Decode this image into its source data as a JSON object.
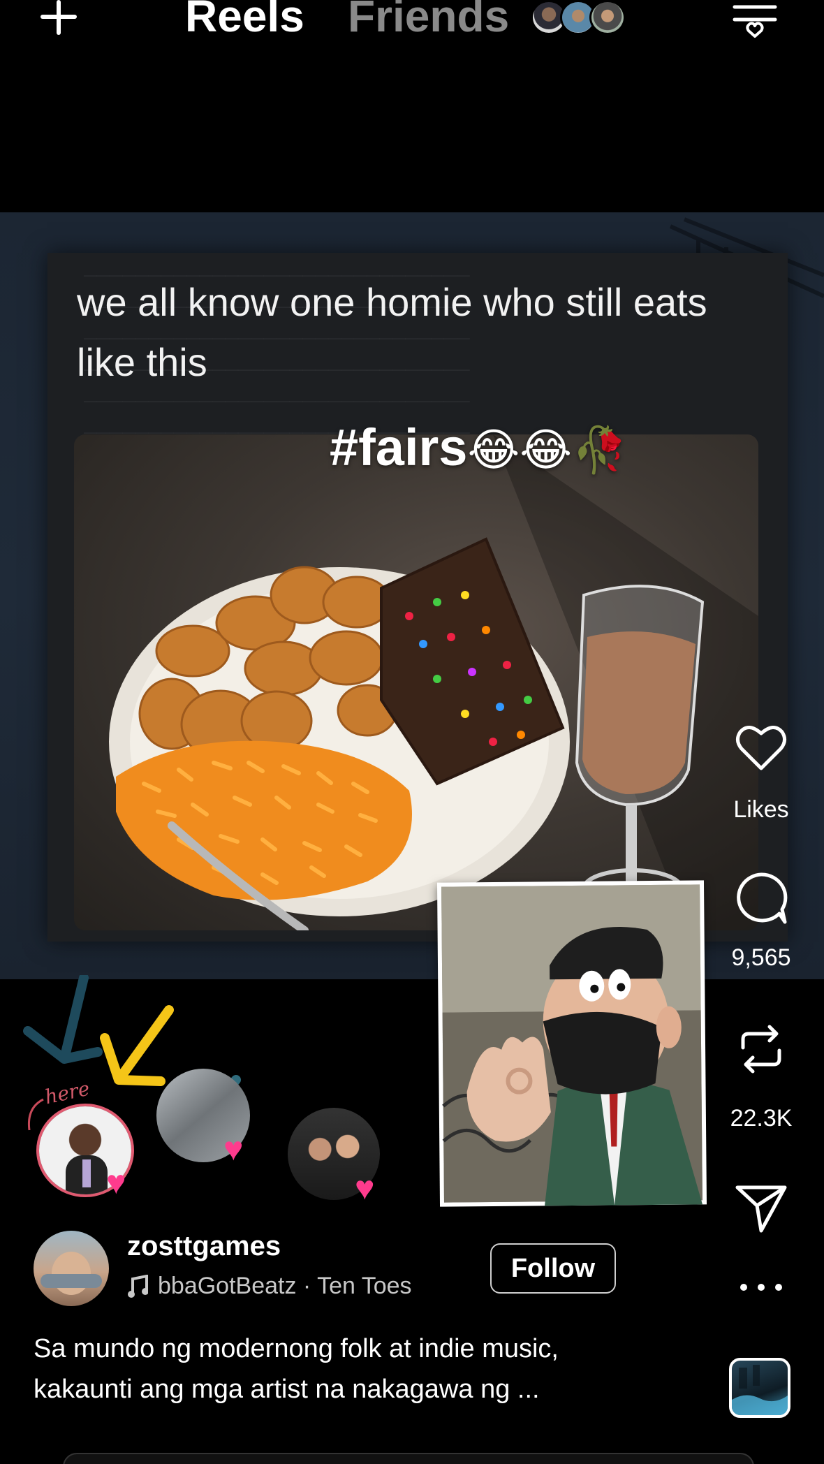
{
  "header": {
    "tabs": [
      {
        "label": "Reels",
        "active": true
      },
      {
        "label": "Friends",
        "active": false
      }
    ]
  },
  "reel": {
    "overlay_text": "we all know one homie who still eats like this",
    "hashtag": "#fairs",
    "hashtag_emojis": "😂😂🥀",
    "annotation_here": "here"
  },
  "actions": {
    "likes_label": "Likes",
    "comments_count": "9,565",
    "reposts_count": "22.3K"
  },
  "author": {
    "username": "zosttgames",
    "audio": "bbaGotBeatz · Ten Toes",
    "follow_label": "Follow"
  },
  "caption": "Sa mundo ng modernong folk at indie music, kakaunti ang mga artist na nakagawa ng ...",
  "colors": {
    "background": "#000000",
    "heart_badge": "#ff3b8d",
    "inactive_tab": "#8a8a8a"
  }
}
